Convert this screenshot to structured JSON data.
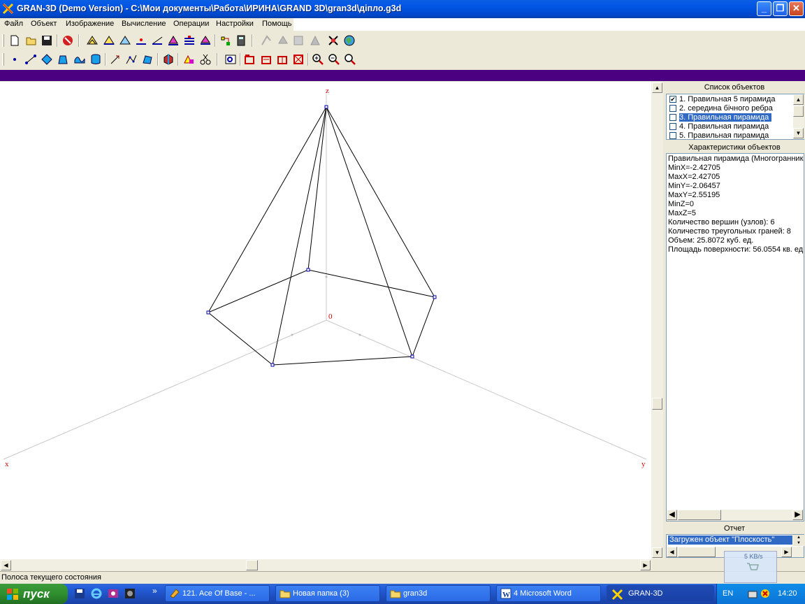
{
  "window": {
    "title": "GRAN-3D (Demo Version) - C:\\Мои документы\\Работа\\ИРИНА\\GRAND 3D\\gran3d\\дiпло.g3d",
    "minimize": "_",
    "maximize": "❐",
    "close": "✕"
  },
  "menu": [
    "Файл",
    "Объект",
    "Изображение",
    "Вычисление",
    "Операции",
    "Настройки",
    "Помощь"
  ],
  "axes": {
    "z": "z",
    "x": "x",
    "y": "y",
    "origin": "0"
  },
  "panel": {
    "list_title": "Список объектов",
    "objects": [
      {
        "label": "1. Правильная 5 пирамида",
        "checked": true
      },
      {
        "label": "2. середина бічного ребра",
        "checked": false
      },
      {
        "label": "3. Правильная пирамида",
        "checked": false,
        "selected": true
      },
      {
        "label": "4. Правильная пирамида",
        "checked": false
      },
      {
        "label": "5. Правильная пирамида",
        "checked": false
      }
    ],
    "chars_title": "Характеристики объектов",
    "chars": [
      "Правильная пирамида (Многогранник",
      "MinX=-2.42705",
      "MaxX=2.42705",
      "MinY=-2.06457",
      "MaxY=2.55195",
      "MinZ=0",
      "MaxZ=5",
      "Количество вершин (узлов): 6",
      "Количество треугольных граней: 8",
      "Объем: 25.8072 куб. ед.",
      "Площадь поверхности: 56.0554 кв. ед."
    ],
    "report_title": "Отчет",
    "report_line": "Загружен объект \"Плоскость\""
  },
  "status": "Полоса текущего состояния",
  "taskbar": {
    "start": "пуск",
    "chevron": "»",
    "tasks": [
      "121. Ace Of Base - ...",
      "Новая папка (3)",
      "gran3d",
      "4 Microsoft Word",
      "GRAN-3D"
    ],
    "lang": "EN",
    "clock": "14:20",
    "net_speed": "5 KB/s"
  },
  "colors": {
    "accent_purple": "#4b0082",
    "selection": "#316ac5",
    "axis_label": "#cc0000"
  }
}
